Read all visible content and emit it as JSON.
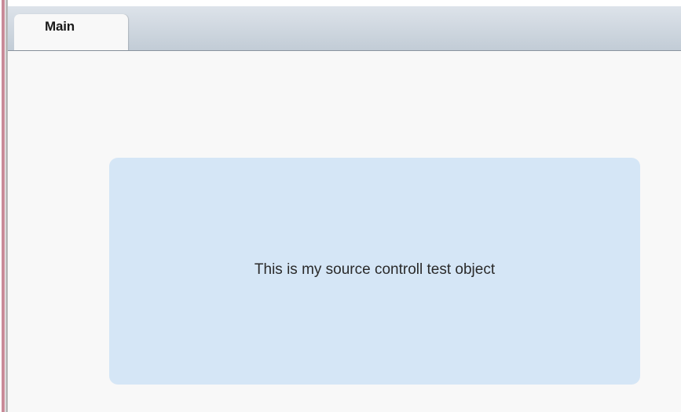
{
  "tabs": [
    {
      "label": "Main",
      "selected": true
    }
  ],
  "content": {
    "panel_text": "This is my source controll test object",
    "panel_color": "#d5e6f6"
  },
  "colors": {
    "background": "#f8f8f8",
    "tab_bar": "#c8d1da",
    "left_accent": "#c88a98"
  }
}
